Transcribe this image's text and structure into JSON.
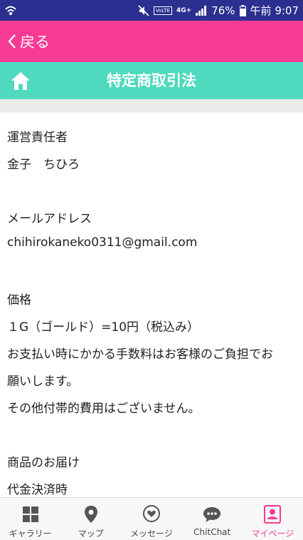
{
  "status_bar": {
    "battery": "76%",
    "time_label": "午前 9:07",
    "network": "4G+",
    "volte": "VoLTE"
  },
  "header": {
    "back_label": "戻る"
  },
  "titlebar": {
    "title": "特定商取引法"
  },
  "content": {
    "lines": [
      "運営責任者",
      "金子　ちひろ",
      "メールアドレス",
      "chihirokaneko0311@gmail.com",
      "価格",
      "１G（ゴールド）=10円（税込み）",
      "お支払い時にかかる手数料はお客様のご負担でお",
      "願いします。",
      "その他付帯的費用はございません。",
      "商品のお届け",
      "代金決済時"
    ]
  },
  "bottom_nav": {
    "items": [
      {
        "label": "ギャラリー",
        "icon": "grid-icon"
      },
      {
        "label": "マップ",
        "icon": "map-pin-icon"
      },
      {
        "label": "メッセージ",
        "icon": "heart-bubble-icon"
      },
      {
        "label": "ChitChat",
        "icon": "chat-bubble-icon"
      },
      {
        "label": "マイページ",
        "icon": "profile-icon",
        "active": true
      }
    ]
  },
  "colors": {
    "status_bar": "#2b2f8f",
    "header": "#f73a93",
    "titlebar": "#4fd9bf",
    "active_nav": "#f73a93"
  }
}
